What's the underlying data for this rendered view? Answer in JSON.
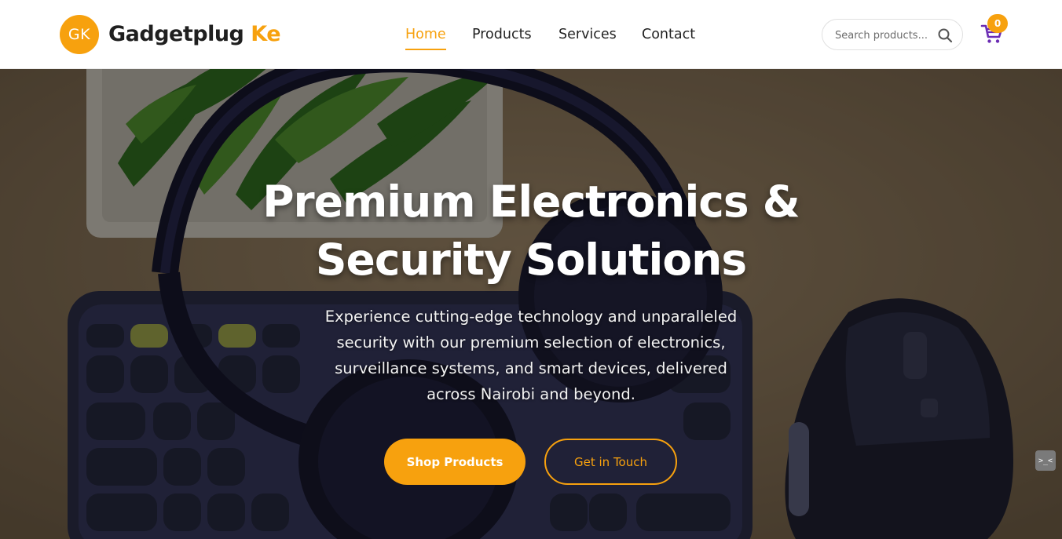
{
  "header": {
    "logo_initials": "GK",
    "brand_name": "Gadgetplug",
    "brand_accent": "Ke",
    "nav": [
      {
        "label": "Home",
        "active": true
      },
      {
        "label": "Products",
        "active": false
      },
      {
        "label": "Services",
        "active": false
      },
      {
        "label": "Contact",
        "active": false
      }
    ],
    "search_placeholder": "Search products...",
    "search_icon": "search-icon",
    "cart_icon": "cart-icon",
    "cart_count": "0"
  },
  "hero": {
    "title_lines": [
      "Premium Electronics &",
      "Security Solutions"
    ],
    "subtitle_lines": [
      "Experience cutting-edge technology and unparalleled",
      "security with our premium selection of electronics,",
      "surveillance systems, and smart devices, delivered",
      "across Nairobi and beyond."
    ],
    "primary_button": "Shop Products",
    "secondary_button": "Get in Touch",
    "side_widget_label": ">_<"
  },
  "colors": {
    "accent": "#f7a10e",
    "text_dark": "#222222",
    "cart_purple": "#6a2bb3"
  }
}
